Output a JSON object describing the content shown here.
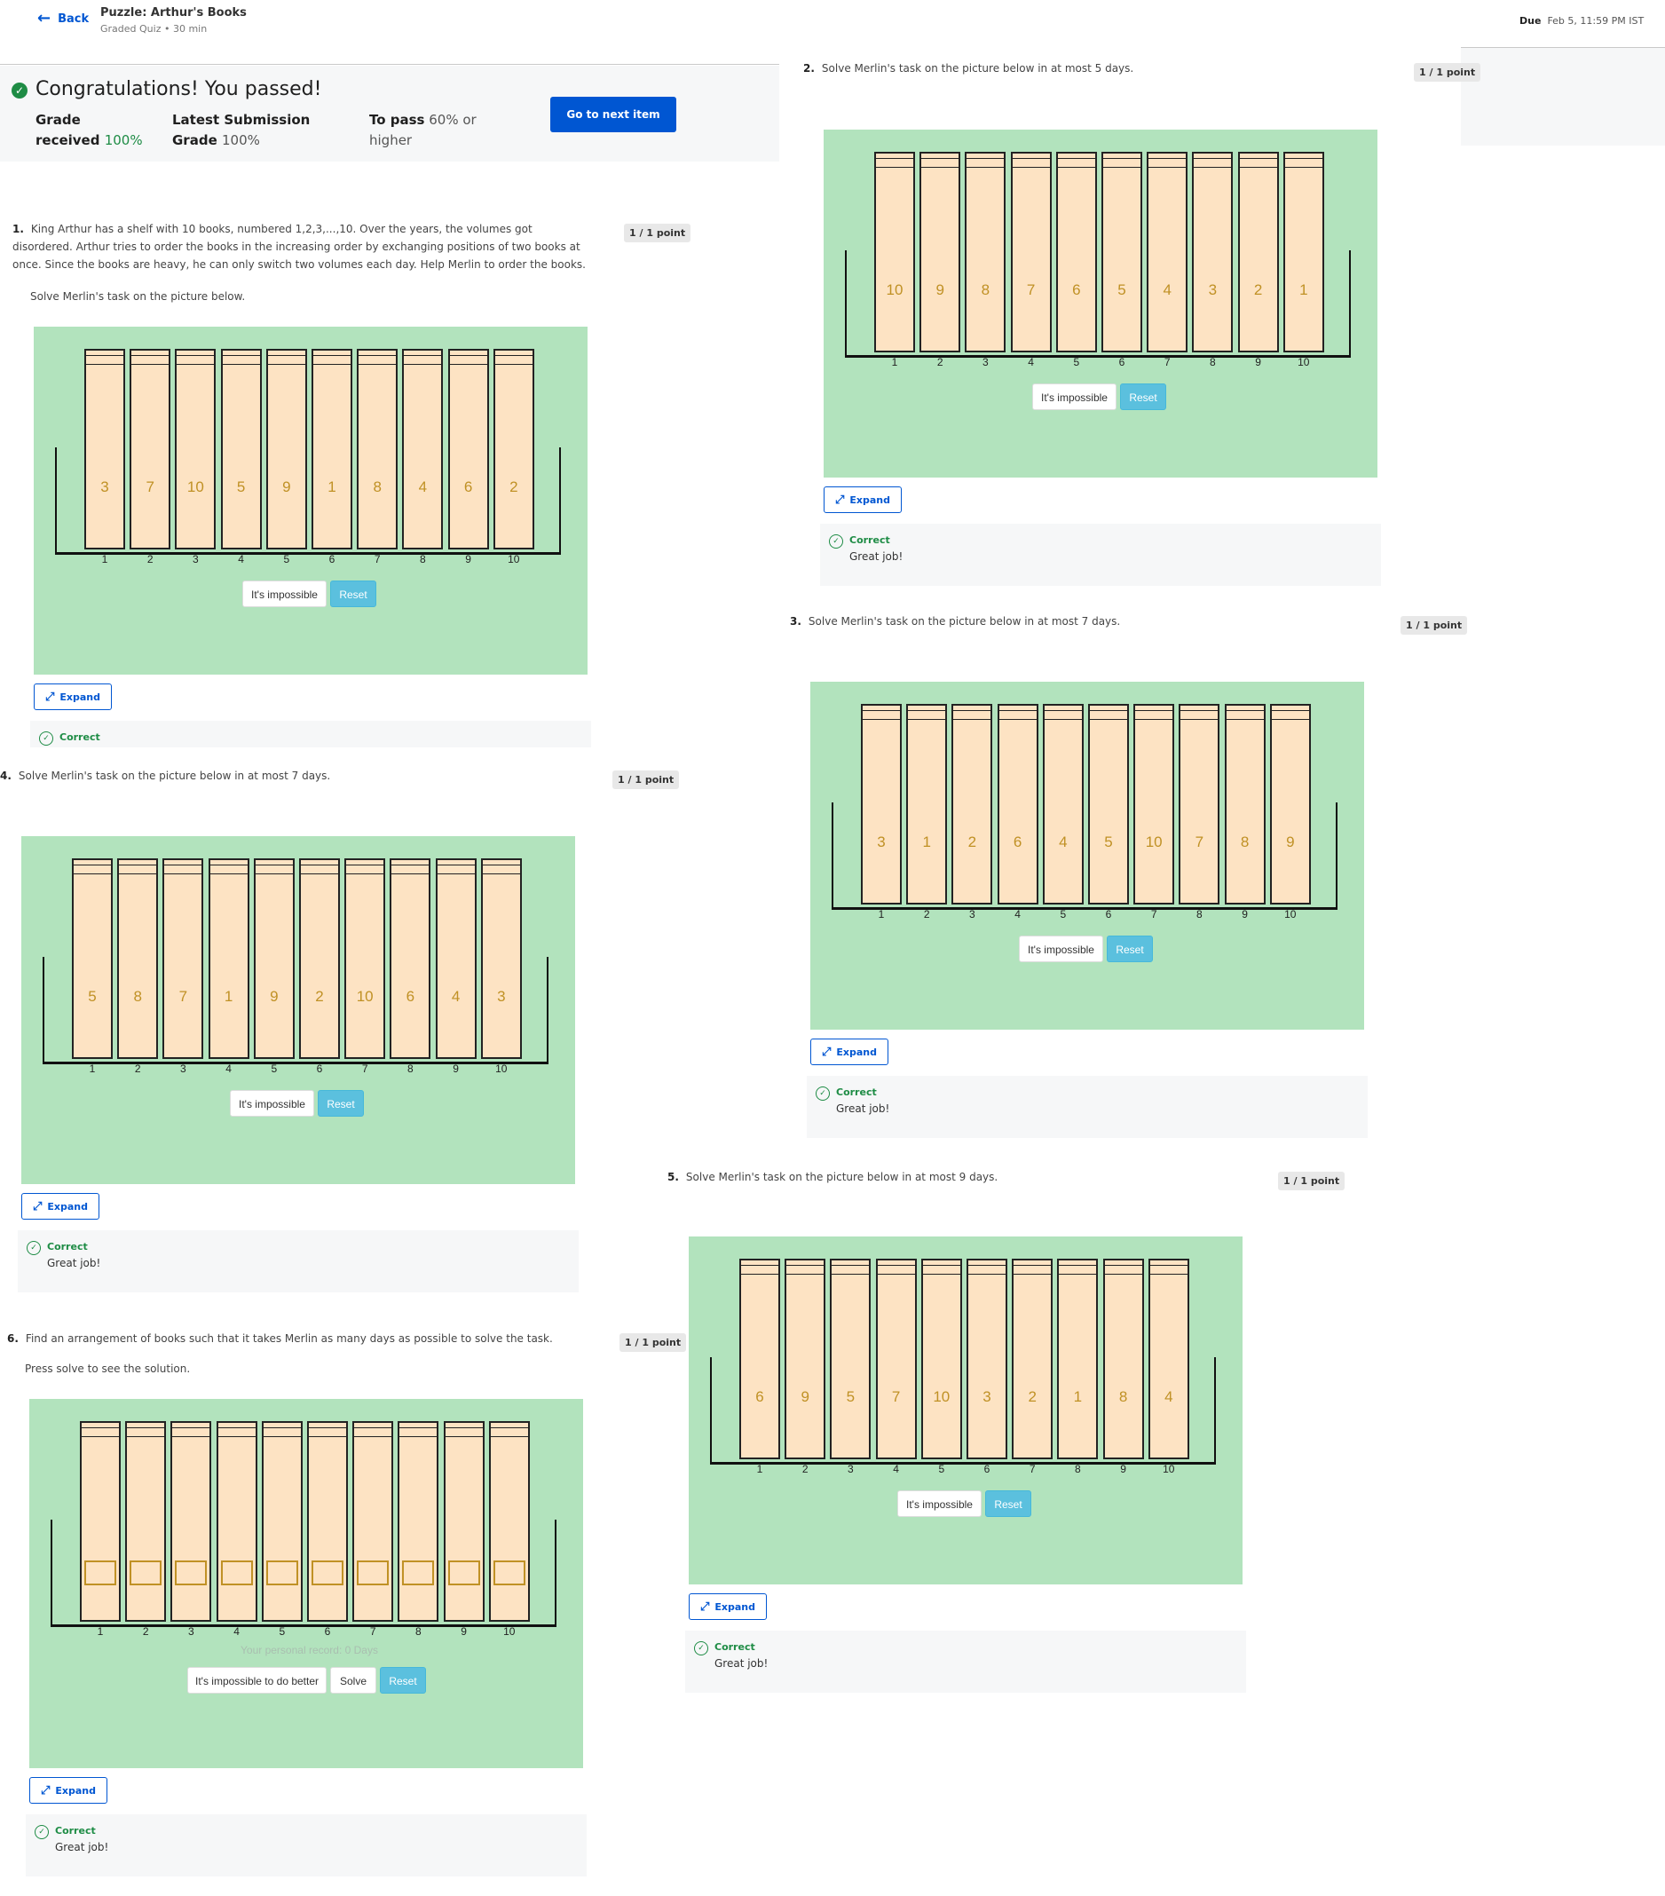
{
  "header": {
    "back_label": "Back",
    "quiz_title": "Puzzle: Arthur's Books",
    "quiz_subtitle": "Graded Quiz • 30 min",
    "due_label": "Due",
    "due_value": "Feb 5, 11:59 PM IST"
  },
  "banner": {
    "title": "Congratulations! You passed!",
    "grade_label_1": "Grade",
    "grade_label_2": "received",
    "grade_value": "100%",
    "latest_label_1": "Latest Submission",
    "latest_label_2": "Grade",
    "latest_value": "100%",
    "topass_label": "To pass",
    "topass_value": "60% or",
    "topass_value2": "higher",
    "next_button": "Go to next item"
  },
  "common": {
    "impossible_label": "It's impossible",
    "reset_label": "Reset",
    "expand_label": "Expand",
    "correct_label": "Correct",
    "great_job": "Great job!",
    "points": "1 / 1 point",
    "positions": [
      "1",
      "2",
      "3",
      "4",
      "5",
      "6",
      "7",
      "8",
      "9",
      "10"
    ]
  },
  "questions": [
    {
      "id": "q1",
      "number": "1.",
      "text": "King Arthur has a shelf with 10 books, numbered 1,2,3,...,10. Over the years, the volumes got disordered. Arthur tries to order the books in the increasing order by exchanging positions of two books at once. Since the books are heavy, he can only switch two volumes each day. Help Merlin to order the books.",
      "subtext": "Solve Merlin's task on the picture below.",
      "books": [
        3,
        7,
        10,
        5,
        9,
        1,
        8,
        4,
        6,
        2
      ]
    },
    {
      "id": "q2",
      "number": "2.",
      "text": "Solve Merlin's task on the picture below in at most 5 days.",
      "books": [
        10,
        9,
        8,
        7,
        6,
        5,
        4,
        3,
        2,
        1
      ]
    },
    {
      "id": "q3",
      "number": "3.",
      "text": "Solve Merlin's task on the picture below in at most 7 days.",
      "books": [
        3,
        1,
        2,
        6,
        4,
        5,
        10,
        7,
        8,
        9
      ]
    },
    {
      "id": "q4",
      "number": "4.",
      "text": "Solve Merlin's task on the picture below in at most 7 days.",
      "books": [
        5,
        8,
        7,
        1,
        9,
        2,
        10,
        6,
        4,
        3
      ]
    },
    {
      "id": "q5",
      "number": "5.",
      "text": "Solve Merlin's task on the picture below in at most 9 days.",
      "books": [
        6,
        9,
        5,
        7,
        10,
        3,
        2,
        1,
        8,
        4
      ]
    },
    {
      "id": "q6",
      "number": "6.",
      "text": "Find an arrangement of books such that it takes Merlin as many days as possible to solve the task.",
      "subtext": "Press solve to see the solution.",
      "books": [],
      "record": "Your personal record: 0 Days",
      "impossible_better": "It's impossible to do better",
      "solve_label": "Solve"
    }
  ]
}
